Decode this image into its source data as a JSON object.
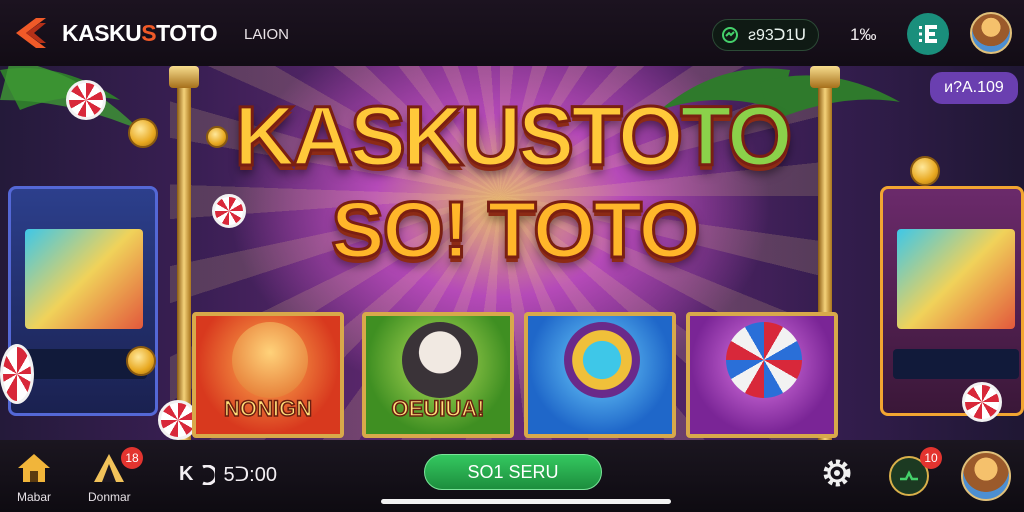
{
  "header": {
    "brand_pre": "KASKU",
    "brand_accent": "S",
    "brand_post": "TOTO",
    "login_label": "LAION",
    "balance": "ƨ93ᑐ1ᑌ",
    "percent": "1‰",
    "menu_icon_text": "E"
  },
  "hero": {
    "title_line1_a": "KASKUSTO",
    "title_line1_b": "TO",
    "title_line2": "SO! TOTO",
    "corner_badge": "ᴎ?A.109",
    "cards": [
      {
        "label": "NONIGN"
      },
      {
        "label": "OEUIUA!"
      },
      {
        "label": ""
      },
      {
        "label": ""
      }
    ]
  },
  "bottom_nav": {
    "home_label": "Mabar",
    "donor_label": "Donmar",
    "donor_badge": "18",
    "timer_prefix": "K",
    "timer_value": "5ᑐ:00",
    "cta_label": "SO1 SERU",
    "wallet_badge": "10"
  },
  "colors": {
    "brand_accent": "#f05a28",
    "cta_green": "#2db452",
    "badge_red": "#e3342f",
    "menu_teal": "#1a8f7c"
  }
}
